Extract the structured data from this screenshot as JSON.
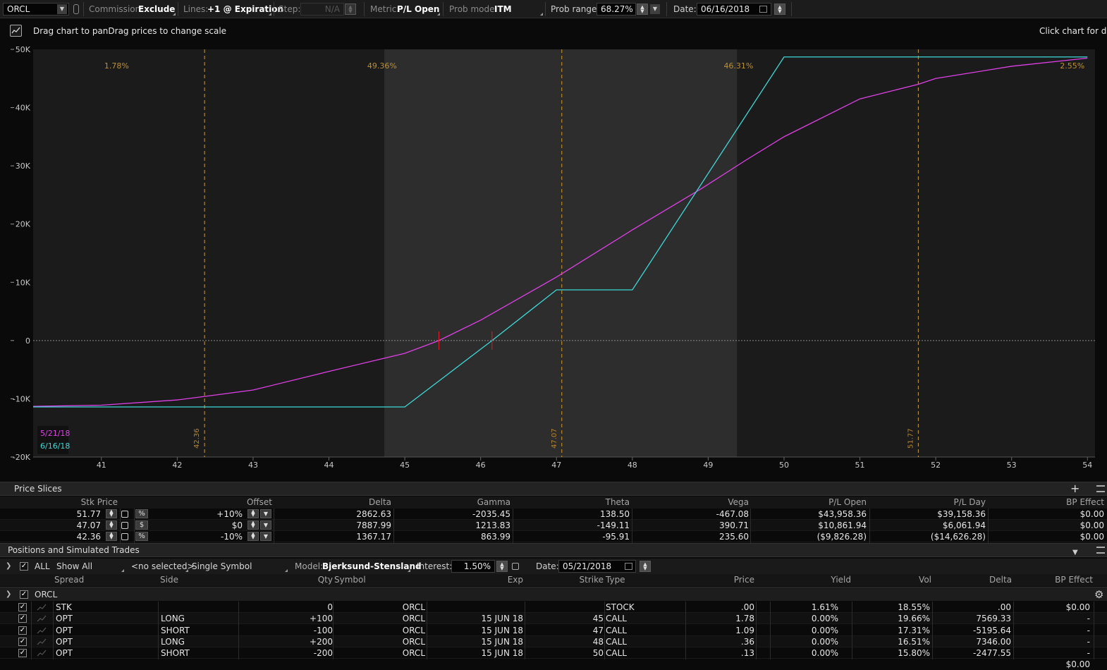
{
  "toolbar": {
    "symbol": "ORCL",
    "commission_label": "Commission:",
    "commission_value": "Exclude",
    "lines_label": "Lines:",
    "lines_value": "+1 @ Expiration",
    "step_label": "Step:",
    "step_value": "N/A",
    "metric_label": "Metric:",
    "metric_value": "P/L Open",
    "probmode_label": "Prob mode:",
    "probmode_value": "ITM",
    "probrange_label": "Prob range:",
    "probrange_value": "68.27%",
    "date_label": "Date:",
    "date_value": "06/16/2018"
  },
  "chart_header": {
    "hint_left": "Drag chart to panDrag prices to change scale",
    "hint_right": "Click chart for data"
  },
  "chart_data": {
    "type": "line",
    "x_ticks": [
      "41",
      "42",
      "43",
      "44",
      "45",
      "46",
      "47",
      "48",
      "49",
      "50",
      "51",
      "52",
      "53",
      "54"
    ],
    "y_ticks": [
      {
        "label": "50K",
        "value": 50000
      },
      {
        "label": "40K",
        "value": 40000
      },
      {
        "label": "30K",
        "value": 30000
      },
      {
        "label": "20K",
        "value": 20000
      },
      {
        "label": "10K",
        "value": 10000
      },
      {
        "label": "0",
        "value": 0
      },
      {
        "label": "-10K",
        "value": -10000
      },
      {
        "label": "-20K",
        "value": -20000
      }
    ],
    "xlim": [
      40.1,
      54.1
    ],
    "ylim": [
      -20000,
      50000
    ],
    "prob_region": [
      44.73,
      49.38
    ],
    "prob_labels": [
      {
        "text": "1.78%",
        "x": 41.2
      },
      {
        "text": "49.36%",
        "x": 44.7
      },
      {
        "text": "46.31%",
        "x": 49.4
      },
      {
        "text": "2.55%",
        "x": 53.8
      }
    ],
    "slice_lines": [
      {
        "x": 42.36,
        "label": "42.36"
      },
      {
        "x": 47.07,
        "label": "47.07"
      },
      {
        "x": 51.77,
        "label": "51.77"
      }
    ],
    "breakevens": [
      45.45,
      46.15
    ],
    "series": [
      {
        "name": "5/21/18",
        "color": "#e040e8",
        "x": [
          40.1,
          41.0,
          42.0,
          42.36,
          43.0,
          44.0,
          45.0,
          45.45,
          46.0,
          47.0,
          48.0,
          48.9,
          49.5,
          50.0,
          51.0,
          51.77,
          52.0,
          53.0,
          54.0
        ],
        "y": [
          -11300,
          -11100,
          -10200,
          -9600,
          -8500,
          -5300,
          -2200,
          0,
          3500,
          10900,
          19000,
          26000,
          31000,
          35000,
          41500,
          44000,
          45000,
          47100,
          48500
        ]
      },
      {
        "name": "6/16/18",
        "color": "#3ed8d8",
        "x": [
          40.1,
          45.0,
          46.15,
          47.0,
          48.0,
          50.0,
          54.0
        ],
        "y": [
          -11400,
          -11400,
          0,
          8700,
          8700,
          48700,
          48700
        ]
      }
    ]
  },
  "price_slices": {
    "title": "Price Slices",
    "columns": [
      "Stk Price",
      "Offset",
      "Delta",
      "Gamma",
      "Theta",
      "Vega",
      "P/L Open",
      "P/L Day",
      "BP Effect"
    ],
    "rows": [
      {
        "price": "51.77",
        "unit": "%",
        "offset": "+10%",
        "delta": "2862.63",
        "gamma": "-2035.45",
        "theta": "138.50",
        "vega": "-467.08",
        "plopen": "$43,958.36",
        "plday": "$39,158.36",
        "bp": "$0.00"
      },
      {
        "price": "47.07",
        "unit": "$",
        "offset": "$0",
        "delta": "7887.99",
        "gamma": "1213.83",
        "theta": "-149.11",
        "vega": "390.71",
        "plopen": "$10,861.94",
        "plday": "$6,061.94",
        "bp": "$0.00"
      },
      {
        "price": "42.36",
        "unit": "%",
        "offset": "-10%",
        "delta": "1367.17",
        "gamma": "863.99",
        "theta": "-95.91",
        "vega": "235.60",
        "plopen": "($9,826.28)",
        "plday": "($14,626.28)",
        "bp": "$0.00"
      }
    ]
  },
  "positions": {
    "title": "Positions and Simulated Trades",
    "filter": {
      "all": "ALL",
      "show": "Show All",
      "selected": "<no selected>",
      "symbol_mode": "Single Symbol",
      "model_label": "Model:",
      "model_value": "Bjerksund-Stensland",
      "interest_label": "Interest:",
      "interest_value": "1.50%",
      "date_label": "Date:",
      "date_value": "05/21/2018"
    },
    "columns": [
      "Spread",
      "Side",
      "Qty",
      "Symbol",
      "Exp",
      "Strike",
      "Type",
      "Price",
      "Yield",
      "Vol",
      "Delta",
      "BP Effect"
    ],
    "group": "ORCL",
    "rows": [
      {
        "spread": "STK",
        "side": "",
        "qty": "0",
        "symbol": "ORCL",
        "exp": "",
        "strike": "",
        "type": "STOCK",
        "price": ".00",
        "yield": "1.61%",
        "vol": "18.55%",
        "delta": ".00",
        "bp": "$0.00"
      },
      {
        "spread": "OPT",
        "side": "LONG",
        "qty": "+100",
        "symbol": "ORCL",
        "exp": "15 JUN 18",
        "strike": "45",
        "type": "CALL",
        "price": "1.78",
        "yield": "0.00%",
        "vol": "19.66%",
        "delta": "7569.33",
        "bp": "-"
      },
      {
        "spread": "OPT",
        "side": "SHORT",
        "qty": "-100",
        "symbol": "ORCL",
        "exp": "15 JUN 18",
        "strike": "47",
        "type": "CALL",
        "price": "1.09",
        "yield": "0.00%",
        "vol": "17.31%",
        "delta": "-5195.64",
        "bp": "-"
      },
      {
        "spread": "OPT",
        "side": "LONG",
        "qty": "+200",
        "symbol": "ORCL",
        "exp": "15 JUN 18",
        "strike": "48",
        "type": "CALL",
        "price": ".36",
        "yield": "0.00%",
        "vol": "16.51%",
        "delta": "7346.00",
        "bp": "-"
      },
      {
        "spread": "OPT",
        "side": "SHORT",
        "qty": "-200",
        "symbol": "ORCL",
        "exp": "15 JUN 18",
        "strike": "50",
        "type": "CALL",
        "price": ".13",
        "yield": "0.00%",
        "vol": "15.80%",
        "delta": "-2477.55",
        "bp": "-"
      }
    ],
    "total_bp": "$0.00"
  }
}
